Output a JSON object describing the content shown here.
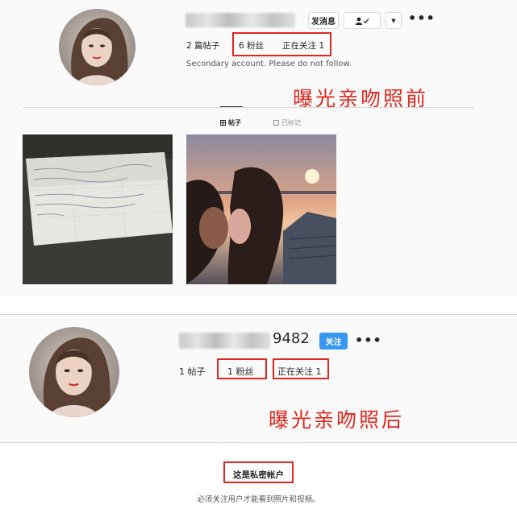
{
  "before": {
    "profile": {
      "username_masked": "",
      "message_label": "发消息",
      "posts": "2 篇帖子",
      "followers": "6 粉丝",
      "following": "正在关注 1",
      "bio": "Secondary account. Please do not follow."
    },
    "annotation": "曝光亲吻照前",
    "tabs": [
      {
        "icon": "grid-icon",
        "label": "帖子"
      },
      {
        "icon": "tag-icon",
        "label": "已标记"
      }
    ],
    "photos": [
      {
        "name": "handwritten-letter-photo"
      },
      {
        "name": "kissing-couple-photo"
      }
    ]
  },
  "after": {
    "profile": {
      "username_suffix": "9482",
      "follow_label": "关注",
      "posts": "1 帖子",
      "followers": "1 粉丝",
      "following": "正在关注 1"
    },
    "annotation": "曝光亲吻照后",
    "private_notice": {
      "title": "这是私密帐户",
      "subtitle": "必须关注用户才能看到照片和视频。"
    }
  },
  "colors": {
    "annotation_red": "#e0271f",
    "follow_blue": "#3897f0"
  }
}
